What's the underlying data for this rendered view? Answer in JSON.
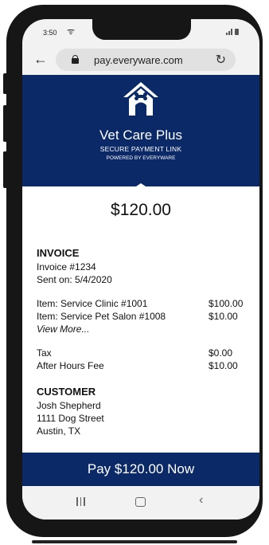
{
  "status_bar": {
    "time": "3:50"
  },
  "browser": {
    "url": "pay.everyware.com"
  },
  "header": {
    "brand": "Vet Care Plus",
    "tagline": "SECURE PAYMENT LINK",
    "powered_by": "POWERED BY EVERYWARE"
  },
  "payment": {
    "amount": "$120.00"
  },
  "invoice": {
    "title": "INVOICE",
    "number": "Invoice #1234",
    "sent": "Sent on: 5/4/2020",
    "items": [
      {
        "label": "Item: Service Clinic #1001",
        "amount": "$100.00"
      },
      {
        "label": "Item: Service Pet Salon #1008",
        "amount": "$10.00"
      }
    ],
    "view_more": "View More...",
    "fees": [
      {
        "label": "Tax",
        "amount": "$0.00"
      },
      {
        "label": "After Hours Fee",
        "amount": "$10.00"
      }
    ]
  },
  "customer": {
    "title": "CUSTOMER",
    "name": "Josh Shepherd",
    "street": "1111 Dog Street",
    "city": "Austin, TX"
  },
  "pay_button": {
    "label": "Pay $120.00 Now"
  },
  "colors": {
    "brand_navy": "#0b2867"
  }
}
